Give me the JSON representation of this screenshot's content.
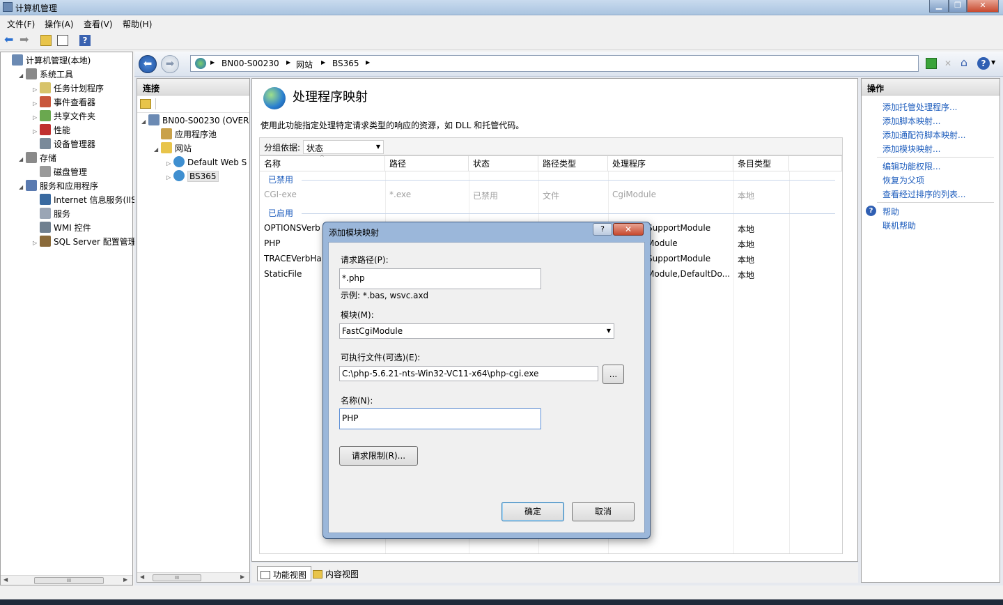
{
  "window": {
    "title": "计算机管理"
  },
  "menu": [
    "文件(F)",
    "操作(A)",
    "查看(V)",
    "帮助(H)"
  ],
  "tree": [
    {
      "label": "计算机管理(本地)",
      "level": 0,
      "icon": "computer-icon",
      "exp": ""
    },
    {
      "label": "系统工具",
      "level": 1,
      "icon": "tools-icon",
      "exp": "◢"
    },
    {
      "label": "任务计划程序",
      "level": 2,
      "icon": "clock-icon",
      "exp": "▷"
    },
    {
      "label": "事件查看器",
      "level": 2,
      "icon": "event-icon",
      "exp": "▷"
    },
    {
      "label": "共享文件夹",
      "level": 2,
      "icon": "share-folder-icon",
      "exp": "▷"
    },
    {
      "label": "性能",
      "level": 2,
      "icon": "performance-icon",
      "exp": "▷"
    },
    {
      "label": "设备管理器",
      "level": 2,
      "icon": "device-icon",
      "exp": ""
    },
    {
      "label": "存储",
      "level": 1,
      "icon": "storage-icon",
      "exp": "◢"
    },
    {
      "label": "磁盘管理",
      "level": 2,
      "icon": "disk-icon",
      "exp": ""
    },
    {
      "label": "服务和应用程序",
      "level": 1,
      "icon": "services-app-icon",
      "exp": "◢"
    },
    {
      "label": "Internet 信息服务(IIS)管",
      "level": 2,
      "icon": "iis-icon",
      "exp": ""
    },
    {
      "label": "服务",
      "level": 2,
      "icon": "gear-icon",
      "exp": ""
    },
    {
      "label": "WMI 控件",
      "level": 2,
      "icon": "wmi-icon",
      "exp": ""
    },
    {
      "label": "SQL Server 配置管理器",
      "level": 2,
      "icon": "sql-icon",
      "exp": "▷"
    }
  ],
  "address": {
    "crumbs": [
      "BN00-S00230",
      "网站",
      "BS365"
    ]
  },
  "connections": {
    "title": "连接",
    "items": [
      {
        "label": "BN00-S00230 (OVER",
        "level": 0,
        "exp": "◢"
      },
      {
        "label": "应用程序池",
        "level": 1,
        "exp": ""
      },
      {
        "label": "网站",
        "level": 1,
        "exp": "◢"
      },
      {
        "label": "Default Web S",
        "level": 2,
        "exp": "▷"
      },
      {
        "label": "BS365",
        "level": 2,
        "exp": "▷"
      }
    ]
  },
  "feature": {
    "title": "处理程序映射",
    "description": "使用此功能指定处理特定请求类型的响应的资源，如 DLL 和托管代码。",
    "group_label": "分组依据:",
    "group_value": "状态",
    "columns": [
      "名称",
      "路径",
      "状态",
      "路径类型",
      "处理程序",
      "条目类型"
    ],
    "group_disabled": "已禁用",
    "group_enabled": "已启用",
    "disabled_rows": [
      [
        "CGI-exe",
        "*.exe",
        "已禁用",
        "文件",
        "CgiModule",
        "本地"
      ]
    ],
    "enabled_rows": [
      [
        "OPTIONSVerb",
        "SupportModule",
        "本地"
      ],
      [
        "PHP",
        "Module",
        "本地"
      ],
      [
        "TRACEVerbHa",
        "SupportModule",
        "本地"
      ],
      [
        "StaticFile",
        "Module,DefaultDo...",
        "本地"
      ]
    ],
    "tabs": [
      "功能视图",
      "内容视图"
    ]
  },
  "actions": {
    "title": "操作",
    "group1": [
      "添加托管处理程序...",
      "添加脚本映射...",
      "添加通配符脚本映射...",
      "添加模块映射..."
    ],
    "group2": [
      "编辑功能权限...",
      "恢复为父项",
      "查看经过排序的列表..."
    ],
    "group3": [
      "帮助",
      "联机帮助"
    ]
  },
  "dialog": {
    "title": "添加模块映射",
    "help_label": "?",
    "close_label": "✕",
    "request_path_label": "请求路径(P):",
    "request_path_value": "*.php",
    "example": "示例: *.bas, wsvc.axd",
    "module_label": "模块(M):",
    "module_value": "FastCgiModule",
    "executable_label": "可执行文件(可选)(E):",
    "executable_value": "C:\\php-5.6.21-nts-Win32-VC11-x64\\php-cgi.exe",
    "browse_label": "...",
    "name_label": "名称(N):",
    "name_value": "PHP",
    "restrictions_label": "请求限制(R)...",
    "ok_label": "确定",
    "cancel_label": "取消"
  }
}
